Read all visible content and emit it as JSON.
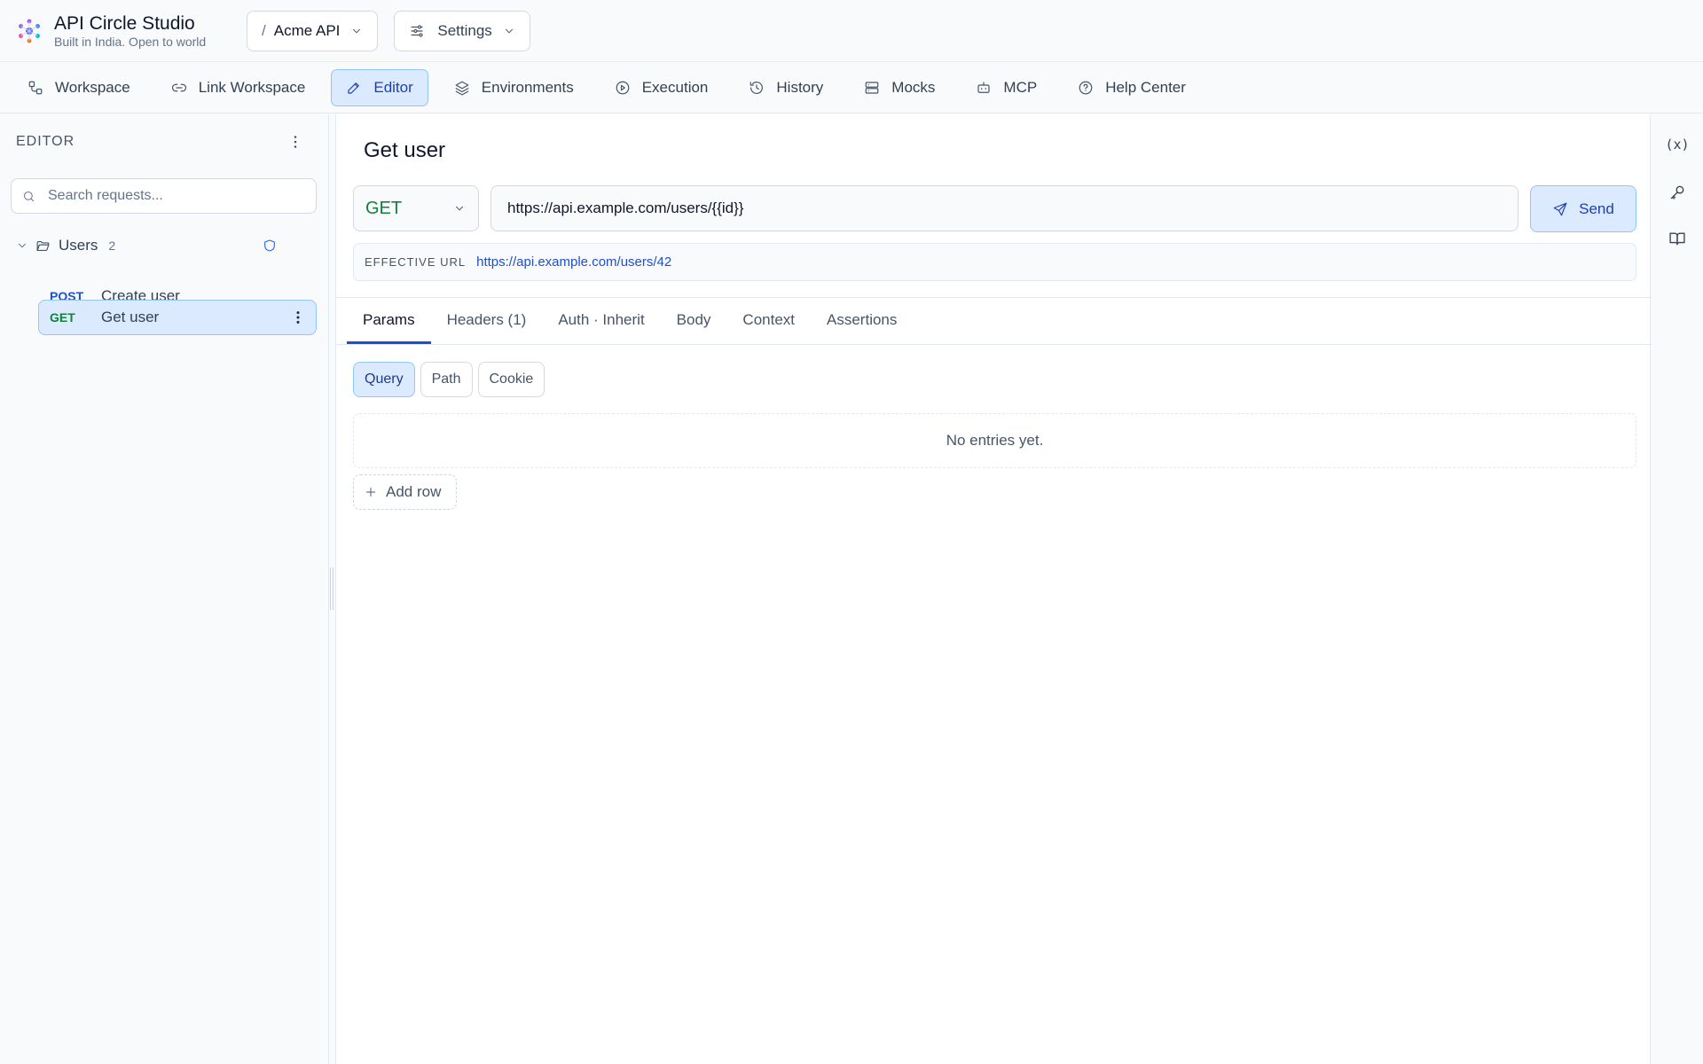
{
  "brand": {
    "title": "API Circle Studio",
    "subtitle": "Built in India. Open to world"
  },
  "header": {
    "project_prefix": "/",
    "project": "Acme API",
    "settings": "Settings"
  },
  "nav": [
    {
      "label": "Workspace",
      "icon": "workspace-icon"
    },
    {
      "label": "Link Workspace",
      "icon": "link-icon"
    },
    {
      "label": "Editor",
      "icon": "pencil-icon",
      "active": true
    },
    {
      "label": "Environments",
      "icon": "layers-icon"
    },
    {
      "label": "Execution",
      "icon": "play-circle-icon"
    },
    {
      "label": "History",
      "icon": "history-icon"
    },
    {
      "label": "Mocks",
      "icon": "server-icon"
    },
    {
      "label": "MCP",
      "icon": "bot-icon"
    },
    {
      "label": "Help Center",
      "icon": "help-circle-icon"
    }
  ],
  "sidebar": {
    "heading": "EDITOR",
    "search_placeholder": "Search requests...",
    "folder": {
      "name": "Users",
      "count": "2"
    },
    "requests": [
      {
        "method": "POST",
        "name": "Create user"
      },
      {
        "method": "GET",
        "name": "Get user",
        "selected": true
      }
    ]
  },
  "request": {
    "title": "Get user",
    "method": "GET",
    "url": "https://api.example.com/users/{{id}}",
    "send": "Send",
    "effective_label": "EFFECTIVE URL",
    "effective_url": "https://api.example.com/users/42"
  },
  "tabs": [
    "Params",
    "Headers (1)",
    "Auth · Inherit",
    "Body",
    "Context",
    "Assertions"
  ],
  "subtabs": [
    "Query",
    "Path",
    "Cookie"
  ],
  "params": {
    "empty": "No entries yet.",
    "add_row": "Add row"
  },
  "rail": {
    "variables_glyph": "(x)"
  },
  "colors": {
    "accent": "#1d4ed8",
    "accent_bg": "#dbeafe",
    "get": "#15803d",
    "post": "#1d4ed8"
  }
}
